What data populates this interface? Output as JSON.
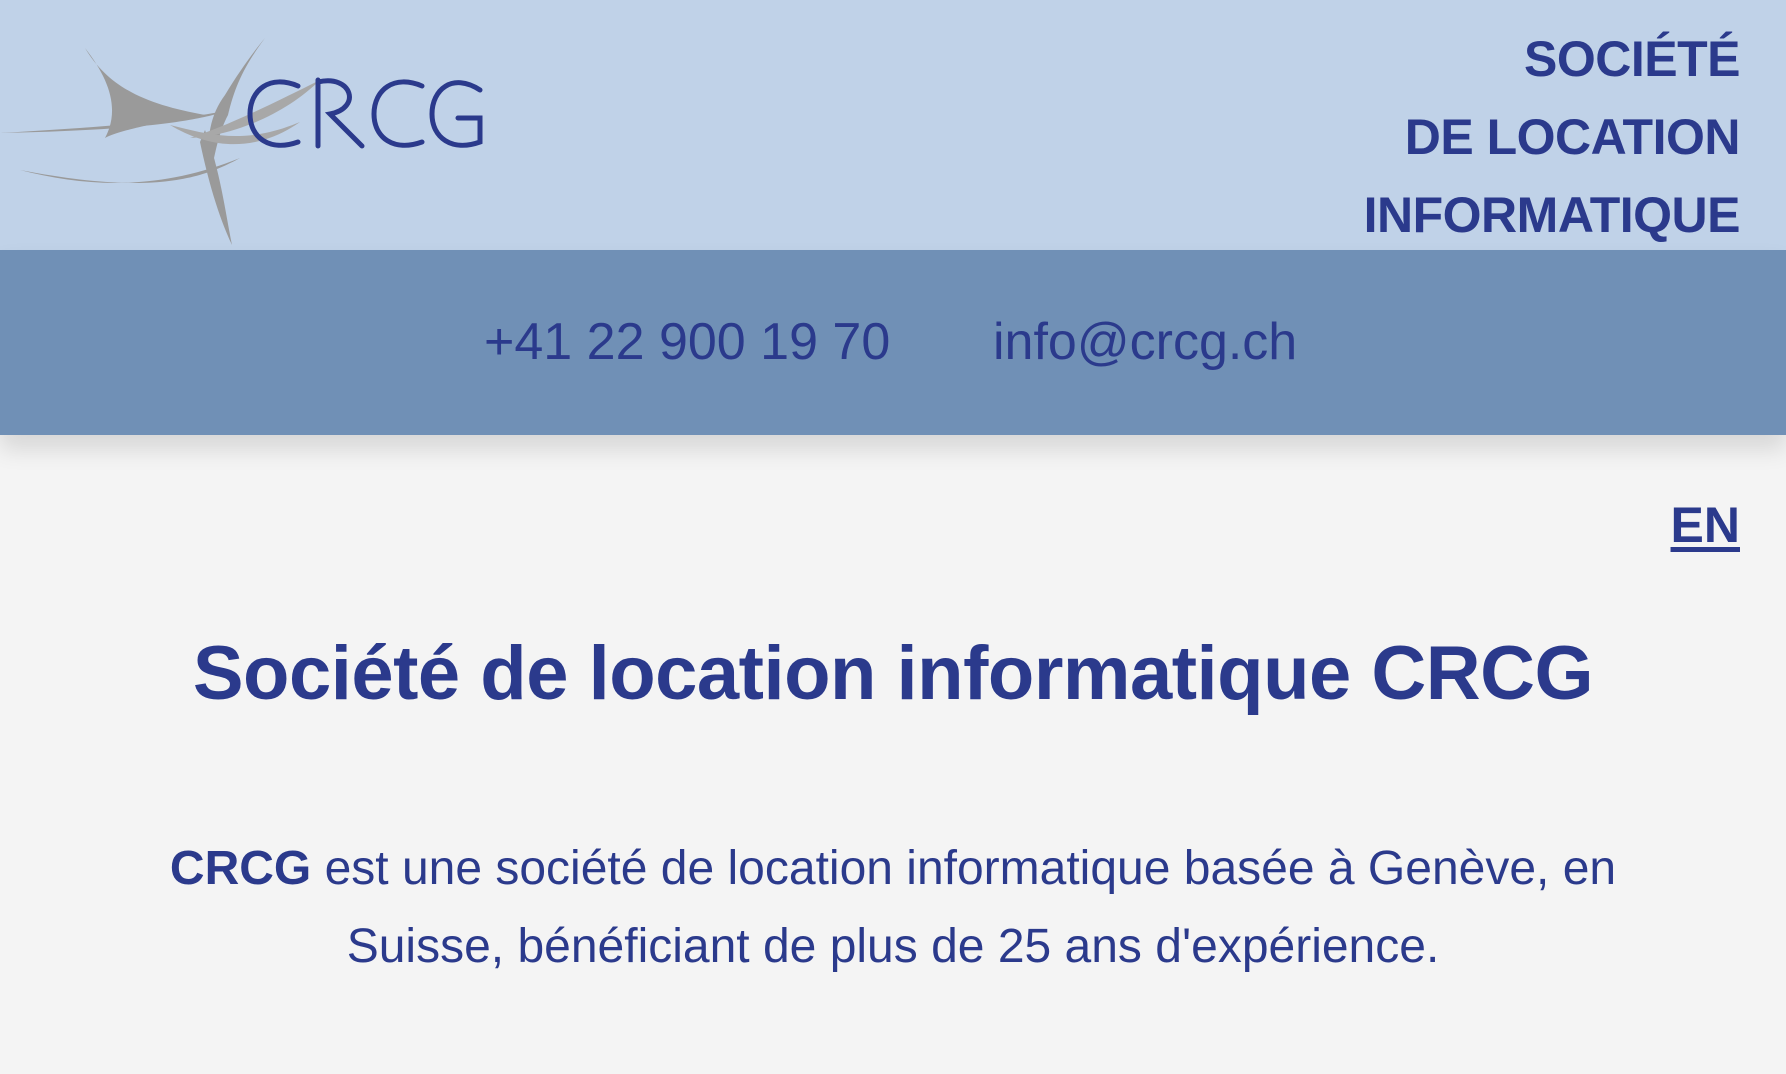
{
  "header": {
    "logo_text": "CRCG",
    "tagline": [
      "SOCIÉTÉ",
      "DE LOCATION",
      "INFORMATIQUE"
    ]
  },
  "contact": {
    "phone": "+41 22 900 19 70",
    "email": "info@crcg.ch"
  },
  "language_switch": {
    "label": "EN"
  },
  "main": {
    "title": "Société de location informatique CRCG",
    "intro_brand": "CRCG",
    "intro_text_line1": " est une société de location informatique basée à Genève, en",
    "intro_text_line2": "Suisse, bénéficiant de plus de 25 ans d'expérience."
  },
  "colors": {
    "top_band": "#c0d2e8",
    "contact_band": "#7090b6",
    "text": "#2b3a8c",
    "page_bg": "#f4f4f4",
    "logo_swoosh": "#9a9a9a"
  }
}
